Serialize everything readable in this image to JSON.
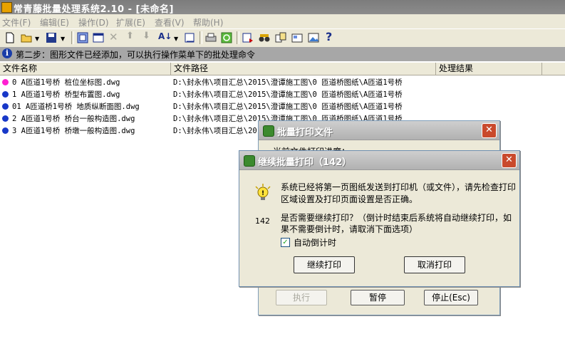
{
  "app": {
    "title": "常青藤批量处理系统2.10 - [未命名]"
  },
  "menu": [
    "文件(F)",
    "编辑(E)",
    "操作(D)",
    "扩展(E)",
    "查看(V)",
    "帮助(H)"
  ],
  "hint": "第二步：图形文件已经添加，可以执行操作菜单下的批处理命令",
  "columns": {
    "name": "文件名称",
    "path": "文件路径",
    "result": "处理结果"
  },
  "files": [
    {
      "color": "#ff1fd2",
      "name": "0 A匝道1号桥 桩位坐标图.dwg",
      "path": "D:\\封永伟\\项目汇总\\2015\\澄谭施工图\\0 匝道桥图纸\\A匝道1号桥"
    },
    {
      "color": "#1838c8",
      "name": "1 A匝道1号桥 桥型布置图.dwg",
      "path": "D:\\封永伟\\项目汇总\\2015\\澄谭施工图\\0 匝道桥图纸\\A匝道1号桥"
    },
    {
      "color": "#1838c8",
      "name": "01 A匝道桥1号桥 地质纵断面图.dwg",
      "path": "D:\\封永伟\\项目汇总\\2015\\澄谭施工图\\0 匝道桥图纸\\A匝道1号桥"
    },
    {
      "color": "#1838c8",
      "name": "2 A匝道1号桥 桥台一般构造图.dwg",
      "path": "D:\\封永伟\\项目汇总\\2015\\澄谭施工图\\0 匝道桥图纸\\A匝道1号桥"
    },
    {
      "color": "#1838c8",
      "name": "3 A匝道1号桥 桥墩一般构造图.dwg",
      "path": "D:\\封永伟\\项目汇总\\2015\\澄谭施工图\\0 匝道桥图纸\\A匝道1号桥"
    }
  ],
  "batch_dialog": {
    "title": "批量打印文件",
    "progress_label": "当前文件打印进度：",
    "buttons": {
      "run": "执行",
      "pause": "暂停",
      "stop": "停止(Esc)"
    }
  },
  "continue_dialog": {
    "title": "继续批量打印（142）",
    "message": "系统已经将第一页图纸发送到打印机（或文件），请先检查打印区域设置及打印页面设置是否正确。",
    "countdown": "142",
    "question": "是否需要继续打印？（倒计时结束后系统将自动继续打印，如果不需要倒计时，请取消下面选项）",
    "checkbox_label": "自动倒计时",
    "checkbox_checked": true,
    "buttons": {
      "continue": "继续打印",
      "cancel": "取消打印"
    }
  }
}
